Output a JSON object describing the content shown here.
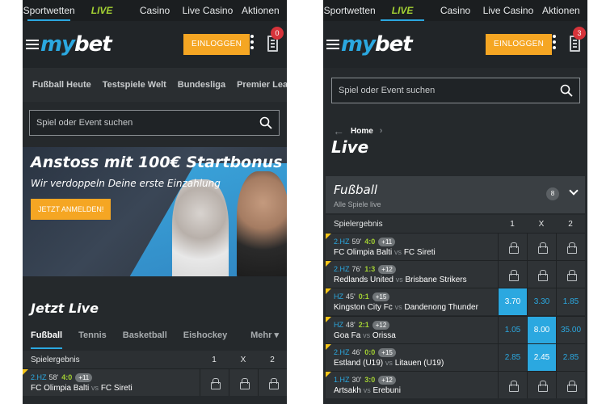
{
  "topnav": {
    "items": [
      "Sportwetten",
      "LIVE",
      "Casino",
      "Live Casino",
      "Aktionen"
    ]
  },
  "header": {
    "logo_my": "my",
    "logo_bet": "bet",
    "login_label": "EINLOGGEN"
  },
  "left": {
    "betslip_count": "0",
    "subnav": [
      "Fußball Heute",
      "Testspiele Welt",
      "Bundesliga",
      "Premier League"
    ],
    "search_placeholder": "Spiel oder Event suchen",
    "banner": {
      "title": "Anstoss mit 100€ Startbonus",
      "subtitle": "Wir verdoppeln Deine erste Einzahlung",
      "cta": "JETZT ANMELDEN!"
    },
    "live_heading": "Jetzt Live",
    "sport_tabs": [
      "Fußball",
      "Tennis",
      "Basketball",
      "Eishockey"
    ],
    "more_label": "Mehr",
    "col_label": "Spielergebnis",
    "cols": [
      "1",
      "X",
      "2"
    ],
    "rows": [
      {
        "half": "2.HZ",
        "minute": "58'",
        "score": "4:0",
        "markets": "+11",
        "home": "FC Olimpia Balti",
        "vs": "vs",
        "away": "FC Sireti"
      }
    ]
  },
  "right": {
    "betslip_count": "3",
    "search_placeholder": "Spiel oder Event suchen",
    "breadcrumb": "Home",
    "title": "Live",
    "section": {
      "title": "Fußball",
      "subtitle": "Alle Spiele live",
      "count": "8"
    },
    "col_label": "Spielergebnis",
    "cols": [
      "1",
      "X",
      "2"
    ],
    "rows": [
      {
        "half": "2.HZ",
        "minute": "59'",
        "score": "4:0",
        "markets": "+11",
        "home": "FC Olimpia Balti",
        "vs": "vs",
        "away": "FC Sireti",
        "odds": [
          "",
          "",
          ""
        ],
        "locked": true,
        "selected": -1
      },
      {
        "half": "2.HZ",
        "minute": "76'",
        "score": "1:3",
        "markets": "+12",
        "home": "Redlands United",
        "vs": "vs",
        "away": "Brisbane Strikers",
        "odds": [
          "",
          "",
          ""
        ],
        "locked": true,
        "selected": -1
      },
      {
        "half": "HZ",
        "minute": "45'",
        "score": "0:1",
        "markets": "+15",
        "home": "Kingston City Fc",
        "vs": "vs",
        "away": "Dandenong Thunder",
        "odds": [
          "3.70",
          "3.30",
          "1.85"
        ],
        "locked": false,
        "selected": 0
      },
      {
        "half": "HZ",
        "minute": "48'",
        "score": "2:1",
        "markets": "+12",
        "home": "Goa Fa",
        "vs": "vs",
        "away": "Orissa",
        "odds": [
          "1.05",
          "8.00",
          "35.00"
        ],
        "locked": false,
        "selected": 1
      },
      {
        "half": "2.HZ",
        "minute": "46'",
        "score": "0:0",
        "markets": "+15",
        "home": "Estland (U19)",
        "vs": "vs",
        "away": "Litauen (U19)",
        "odds": [
          "2.85",
          "2.45",
          "2.85"
        ],
        "locked": false,
        "selected": 1
      },
      {
        "half": "1.HZ",
        "minute": "30'",
        "score": "3:0",
        "markets": "+12",
        "home": "Artsakh",
        "vs": "vs",
        "away": "Erebuni",
        "odds": [
          "",
          "",
          ""
        ],
        "locked": true,
        "selected": -1
      }
    ]
  },
  "colors": {
    "accent_blue": "#2ba8e0",
    "live_green": "#a4d233",
    "cta_orange": "#f5a623",
    "badge_red": "#d6333a"
  }
}
